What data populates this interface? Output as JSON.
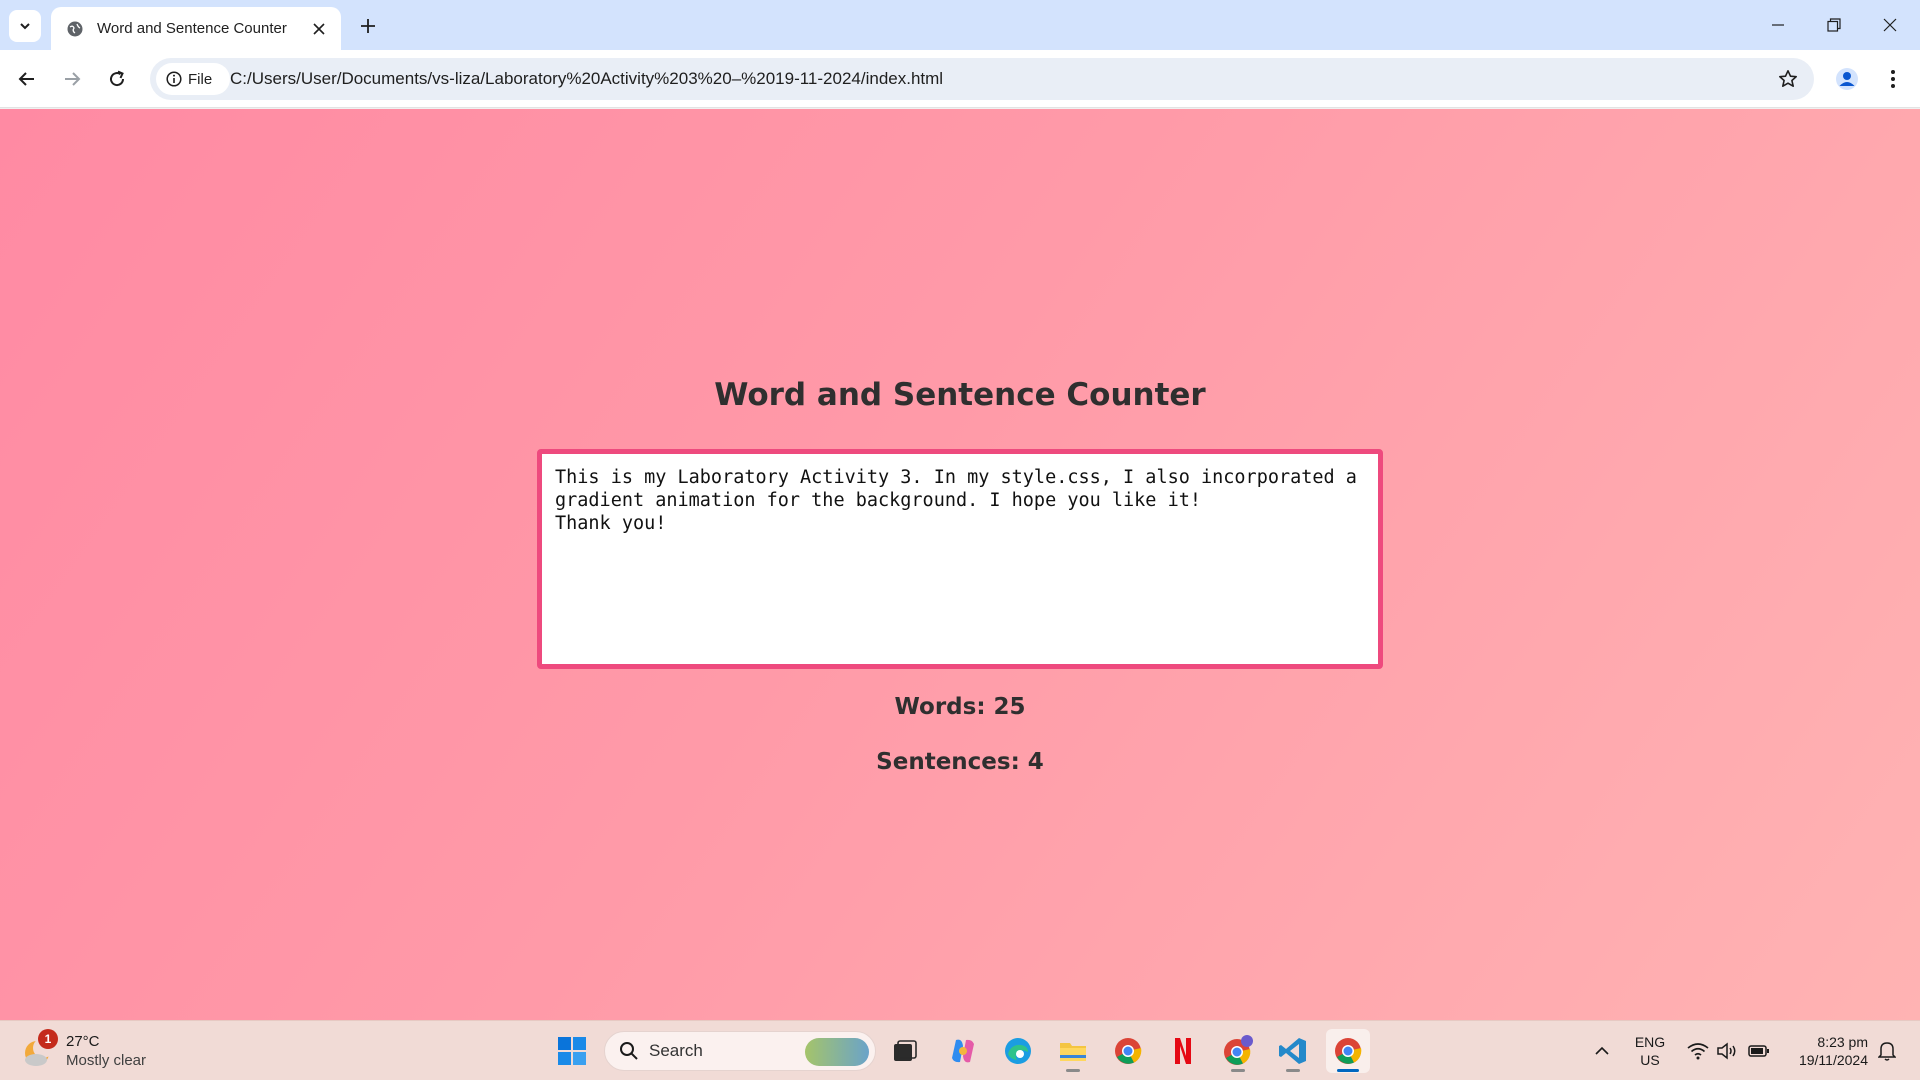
{
  "browser": {
    "tab_title": "Word and Sentence Counter",
    "site_chip_label": "File",
    "url": "C:/Users/User/Documents/vs-liza/Laboratory%20Activity%203%20–%2019-11-2024/index.html"
  },
  "page": {
    "title": "Word and Sentence Counter",
    "textarea_value": "This is my Laboratory Activity 3. In my style.css, I also incorporated a\ngradient animation for the background. I hope you like it!\nThank you!",
    "words_text": "Words: 25",
    "sentences_text": "Sentences: 4",
    "accent_color": "#ee4a7e"
  },
  "taskbar": {
    "weather_badge": "1",
    "weather_temp": "27°C",
    "weather_desc": "Mostly clear",
    "search_label": "Search",
    "lang_line1": "ENG",
    "lang_line2": "US",
    "time": "8:23 pm",
    "date": "19/11/2024",
    "apps": [
      "start-icon",
      "task-view-icon",
      "copilot-icon",
      "edge-icon",
      "file-explorer-icon",
      "chrome-icon",
      "netflix-icon",
      "chrome-profile-icon",
      "vscode-icon",
      "chrome-active-icon"
    ]
  }
}
